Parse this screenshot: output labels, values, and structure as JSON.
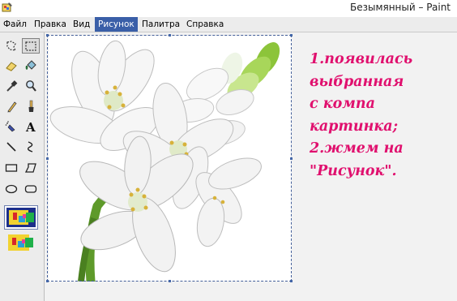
{
  "window": {
    "title": "Безымянный – Paint",
    "icon": "paint-app-icon"
  },
  "menu": [
    {
      "label": "Файл",
      "active": false
    },
    {
      "label": "Правка",
      "active": false
    },
    {
      "label": "Вид",
      "active": false
    },
    {
      "label": "Рисунок",
      "active": true
    },
    {
      "label": "Палитра",
      "active": false
    },
    {
      "label": "Справка",
      "active": false
    }
  ],
  "tools": [
    {
      "name": "free-form-select-icon"
    },
    {
      "name": "rect-select-icon",
      "selected": true
    },
    {
      "name": "eraser-icon"
    },
    {
      "name": "fill-bucket-icon"
    },
    {
      "name": "color-picker-icon"
    },
    {
      "name": "magnifier-icon"
    },
    {
      "name": "pencil-icon"
    },
    {
      "name": "brush-icon"
    },
    {
      "name": "airbrush-icon"
    },
    {
      "name": "text-icon",
      "glyph": "A"
    },
    {
      "name": "line-icon"
    },
    {
      "name": "curve-icon"
    },
    {
      "name": "rectangle-icon"
    },
    {
      "name": "polygon-icon"
    },
    {
      "name": "ellipse-icon"
    },
    {
      "name": "rounded-rectangle-icon"
    }
  ],
  "selection_options": [
    {
      "name": "opaque-selection-icon",
      "selected": true
    },
    {
      "name": "transparent-selection-icon",
      "selected": false
    }
  ],
  "canvas": {
    "image": "white-flower-image"
  },
  "note": {
    "lines": [
      "1.появилась",
      "выбранная",
      "с компа",
      "картинка;",
      "2.жмем на",
      "\"Рисунок\"."
    ],
    "color": "#e0106e"
  },
  "colors": {
    "menu_highlight": "#3a5fa8",
    "selection_border": "#44609a"
  }
}
